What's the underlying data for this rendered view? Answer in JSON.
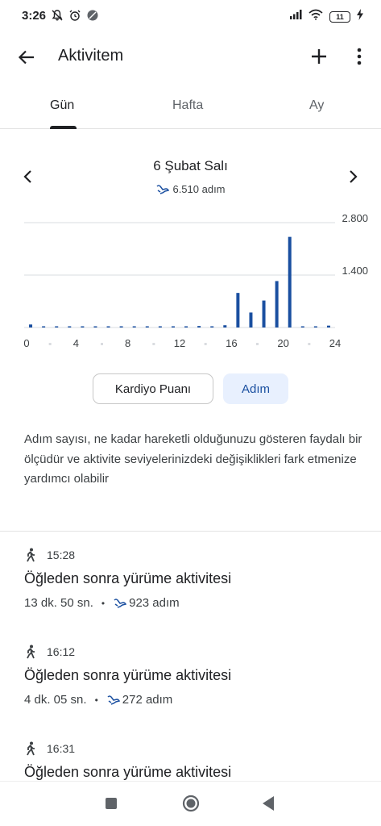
{
  "status_bar": {
    "time": "3:26",
    "battery": "11"
  },
  "app_bar": {
    "title": "Aktivitem"
  },
  "tabs": [
    {
      "label": "Gün",
      "active": true
    },
    {
      "label": "Hafta",
      "active": false
    },
    {
      "label": "Ay",
      "active": false
    }
  ],
  "day": {
    "title": "6 Şubat Salı",
    "steps": "6.510 adım"
  },
  "chart_data": {
    "type": "bar",
    "x": [
      0,
      1,
      2,
      3,
      4,
      5,
      6,
      7,
      8,
      9,
      10,
      11,
      12,
      13,
      14,
      15,
      16,
      17,
      18,
      19,
      20,
      21,
      22,
      23
    ],
    "values": [
      80,
      10,
      10,
      10,
      10,
      10,
      10,
      10,
      10,
      10,
      10,
      10,
      10,
      40,
      10,
      60,
      923,
      400,
      720,
      1240,
      2420,
      30,
      10,
      50
    ],
    "x_tick_labels": [
      "0",
      "4",
      "8",
      "12",
      "16",
      "20",
      "24"
    ],
    "x_ticks": [
      0,
      4,
      8,
      12,
      16,
      20,
      24
    ],
    "y_tick_labels": [
      "2.800",
      "1.400"
    ],
    "y_ticks": [
      2800,
      1400
    ],
    "xlim": [
      0,
      24
    ],
    "ylim": [
      0,
      2800
    ],
    "grid": true,
    "bar_color": "#1a4fa0"
  },
  "toggle": {
    "kardiyo": "Kardiyo Puanı",
    "adim": "Adım"
  },
  "description": "Adım sayısı, ne kadar hareketli olduğunuzu gösteren faydalı bir ölçüdür ve aktivite seviyelerinizdeki değişiklikleri fark etmenize yardımcı olabilir",
  "activities": [
    {
      "time": "15:28",
      "title": "Öğleden sonra yürüme aktivitesi",
      "duration": "13 dk. 50 sn.",
      "steps": "923 adım"
    },
    {
      "time": "16:12",
      "title": "Öğleden sonra yürüme aktivitesi",
      "duration": "4 dk. 05 sn.",
      "steps": "272 adım"
    },
    {
      "time": "16:31",
      "title": "Öğleden sonra yürüme aktivitesi"
    }
  ],
  "colors": {
    "accent": "#1a4fa0",
    "text_primary": "#202124",
    "text_secondary": "#3c4043"
  }
}
